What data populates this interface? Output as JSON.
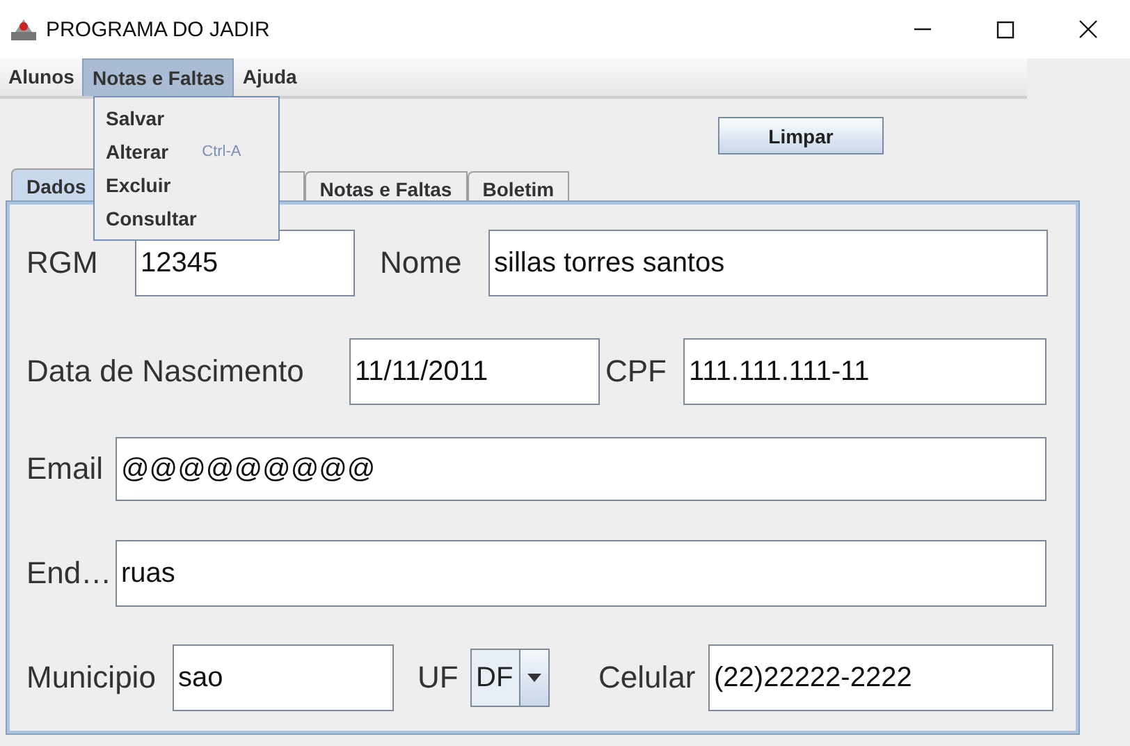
{
  "window": {
    "title": "PROGRAMA DO JADIR"
  },
  "menu_bar": [
    {
      "label": "Alunos",
      "selected": false
    },
    {
      "label": "Notas e Faltas",
      "selected": true
    },
    {
      "label": "Ajuda",
      "selected": false
    }
  ],
  "open_menu": {
    "items": [
      {
        "label": "Salvar"
      },
      {
        "label": "Alterar",
        "shortcut": "Ctrl-A"
      },
      {
        "label": "Excluir"
      },
      {
        "label": "Consultar"
      }
    ]
  },
  "clear_button": "Limpar",
  "tabs": [
    {
      "label": "Dados",
      "selected": true
    },
    {
      "selected": false
    },
    {
      "label": "Notas e Faltas",
      "selected": false
    },
    {
      "label": "Boletim",
      "selected": false
    }
  ],
  "form": {
    "rows": [
      {
        "fields": [
          {
            "label": "RGM",
            "value": "12345",
            "kind": "text"
          },
          {
            "label": "Nome",
            "value": "sillas torres santos",
            "kind": "text"
          }
        ]
      },
      {
        "fields": [
          {
            "label": "Data de Nascimento",
            "value": "11/11/2011",
            "kind": "text"
          },
          {
            "label": "CPF",
            "value": "111.111.111-11",
            "kind": "text"
          }
        ]
      },
      {
        "fields": [
          {
            "label": "Email",
            "value": "@@@@@@@@@",
            "kind": "text"
          }
        ]
      },
      {
        "fields": [
          {
            "label": "End…",
            "value": "ruas",
            "kind": "text"
          }
        ]
      },
      {
        "fields": [
          {
            "label": "Municipio",
            "value": "sao",
            "kind": "text"
          },
          {
            "label": "UF",
            "value": "DF",
            "kind": "combo"
          },
          {
            "label": "Celular",
            "value": "(22)22222-2222",
            "kind": "text"
          }
        ]
      }
    ]
  }
}
